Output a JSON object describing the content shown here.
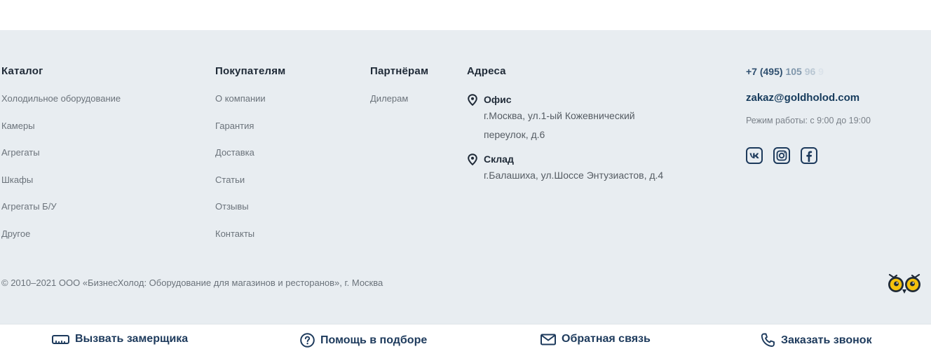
{
  "catalog": {
    "title": "Каталог",
    "items": [
      "Холодильное оборудование",
      "Камеры",
      "Агрегаты",
      "Шкафы",
      "Агрегаты Б/У",
      "Другое"
    ]
  },
  "buyers": {
    "title": "Покупателям",
    "items": [
      "О компании",
      "Гарантия",
      "Доставка",
      "Статьи",
      "Отзывы",
      "Контакты"
    ]
  },
  "partners": {
    "title": "Партнёрам",
    "items": [
      "Дилерам"
    ]
  },
  "addresses": {
    "title": "Адреса",
    "office": {
      "name": "Офис",
      "line1": "г.Москва, ул.1-ый Кожевнический",
      "line2": "переулок, д.6"
    },
    "warehouse": {
      "name": "Склад",
      "line1": "г.Балашиха, ул.Шоссе Энтузиастов, д.4"
    }
  },
  "contacts": {
    "phone_part1": "+7 (495)",
    "phone_part2": "105",
    "phone_part3": "96",
    "phone_part4": "9",
    "email": "zakaz@goldholod.com",
    "hours": "Режим работы: с 9:00 до 19:00",
    "social_icons": [
      "vk-icon",
      "instagram-icon",
      "facebook-icon"
    ]
  },
  "copyright": "© 2010–2021 ООО «БизнесХолод: Оборудование для магазинов и ресторанов», г. Москва",
  "bottom_bar": {
    "measure": "Вызвать замерщика",
    "help": "Помощь в подборе",
    "feedback": "Обратная связь",
    "callback": "Заказать звонок"
  },
  "colors": {
    "footer_bg": "#e8edf1",
    "heading": "#1f2a37",
    "link": "#6b737b",
    "accent": "#1d3a5c",
    "owl_eye": "#f4c20d"
  }
}
